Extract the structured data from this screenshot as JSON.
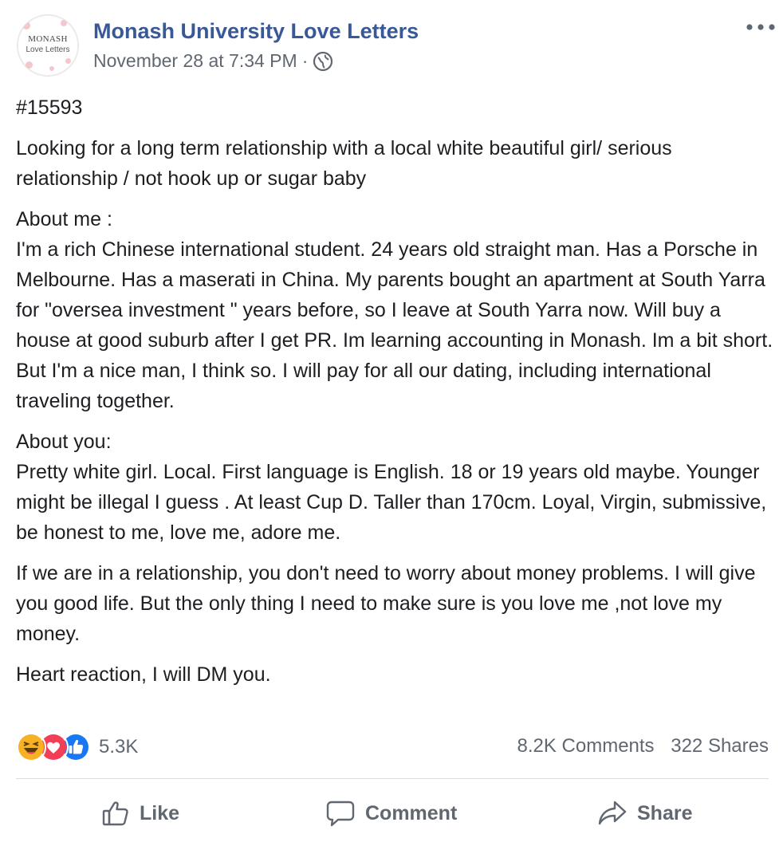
{
  "page": {
    "avatar_line1": "MONASH",
    "avatar_line2": "Love Letters",
    "name": "Monash University Love Letters",
    "timestamp": "November 28 at 7:34 PM",
    "separator": "·",
    "audience_icon": "globe-icon",
    "more_icon": "more-options-icon"
  },
  "post": {
    "paragraphs": [
      "#15593",
      "Looking for a long term relationship with a local white beautiful girl/ serious relationship / not hook up or sugar baby",
      "About me :\nI'm a rich Chinese international student. 24 years old straight man. Has a Porsche in Melbourne. Has a maserati in China. My parents bought an apartment at South Yarra for \"oversea investment \" years before, so I leave at South Yarra now. Will buy a house at good suburb after I get PR. Im learning accounting in Monash. Im a bit short. But I'm a nice man, I think so. I will pay for all our dating, including international traveling together.",
      "About you:\nPretty white girl. Local. First language is English. 18 or 19 years old maybe. Younger might be illegal I guess . At least Cup D. Taller than 170cm. Loyal, Virgin, submissive, be honest to me, love me, adore me.",
      "If we are in a relationship, you don't need to worry about money problems. I will give you good life. But the only thing I need to make sure is you love me ,not love my money.",
      "Heart reaction, I will DM you."
    ]
  },
  "engagement": {
    "reaction_icons": [
      "haha-reaction-icon",
      "love-reaction-icon",
      "like-reaction-icon"
    ],
    "reaction_count": "5.3K",
    "comments": "8.2K Comments",
    "shares": "322 Shares"
  },
  "actions": {
    "like": "Like",
    "comment": "Comment",
    "share": "Share"
  },
  "colors": {
    "page_name": "#385898",
    "secondary_text": "#606770",
    "like_blue": "#1877f2",
    "love_red": "#f33e58",
    "haha_yellow": "#f7b125"
  }
}
